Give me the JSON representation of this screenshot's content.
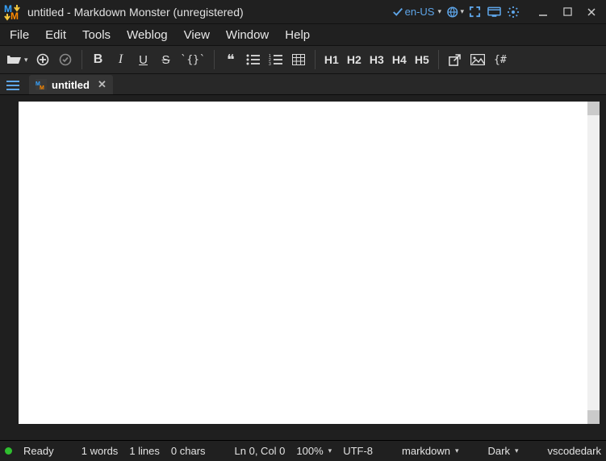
{
  "title": "untitled  - Markdown Monster (unregistered)",
  "lang_label": "en-US",
  "menu": {
    "file": "File",
    "edit": "Edit",
    "tools": "Tools",
    "weblog": "Weblog",
    "view": "View",
    "window": "Window",
    "help": "Help"
  },
  "headings": {
    "h1": "H1",
    "h2": "H2",
    "h3": "H3",
    "h4": "H4",
    "h5": "H5"
  },
  "codebtn": "`{}`",
  "bold": "B",
  "italic": "I",
  "underline": "U",
  "strike": "S",
  "quote": "❝",
  "hashbrace": "{#",
  "tab": {
    "label": "untitled"
  },
  "status": {
    "ready": "Ready",
    "words": "1 words",
    "lines": "1 lines",
    "chars": "0 chars",
    "pos": "Ln 0, Col 0",
    "zoom": "100%",
    "enc": "UTF-8",
    "syntax": "markdown",
    "theme": "Dark",
    "editor_theme": "vscodedark"
  }
}
